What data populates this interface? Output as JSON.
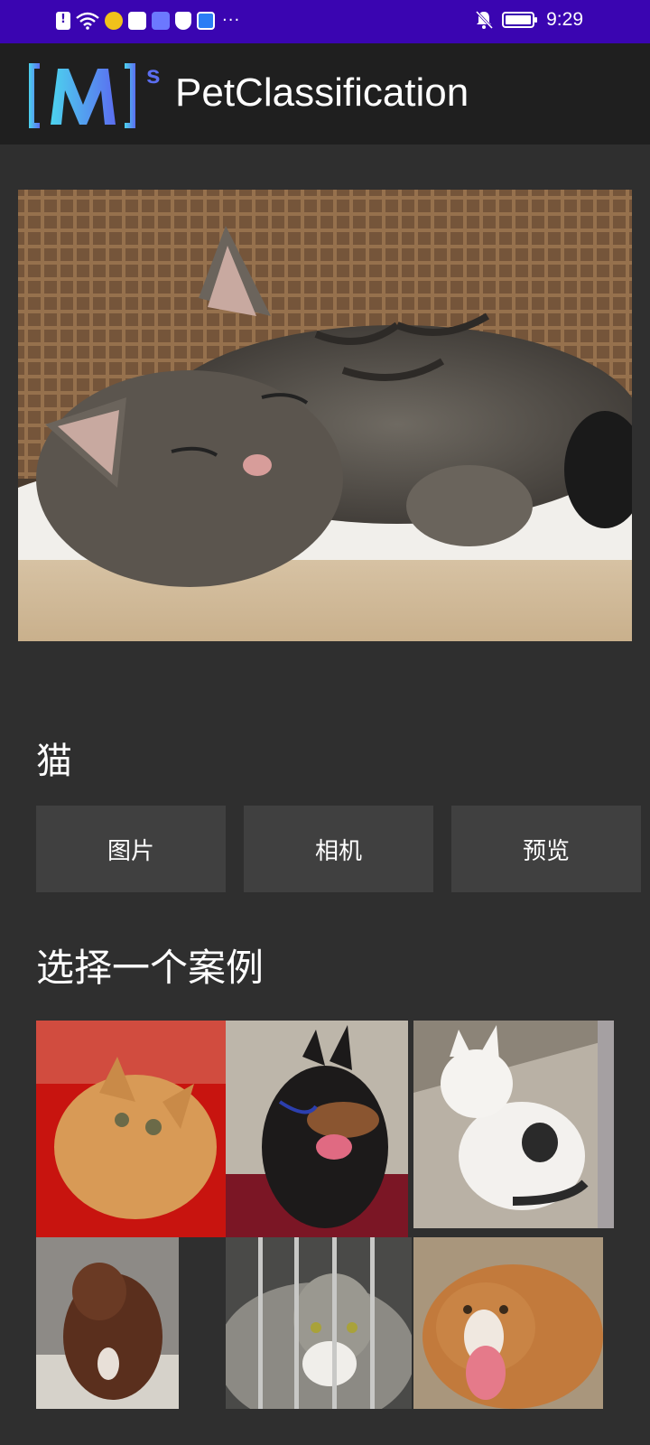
{
  "status_bar": {
    "time": "9:29",
    "icons_left": [
      "notification-icon",
      "wifi-icon",
      "weibo-icon",
      "baidu-icon",
      "app-icon",
      "shield-icon",
      "app-icon"
    ],
    "more": "···",
    "icons_right": [
      "bell-off-icon",
      "battery-icon"
    ]
  },
  "app_bar": {
    "title": "PetClassification",
    "logo_icon": "mindspore-logo"
  },
  "main": {
    "result_label": "猫",
    "buttons": {
      "image": "图片",
      "camera": "相机",
      "preview": "预览"
    },
    "examples_title": "选择一个案例"
  },
  "colors": {
    "status_bar": "#3a05b1",
    "app_bar": "#1f1f1f",
    "background": "#2f2f2f",
    "button": "#404040",
    "logo_gradient_start": "#4cd3ee",
    "logo_gradient_end": "#5b6ef0"
  }
}
